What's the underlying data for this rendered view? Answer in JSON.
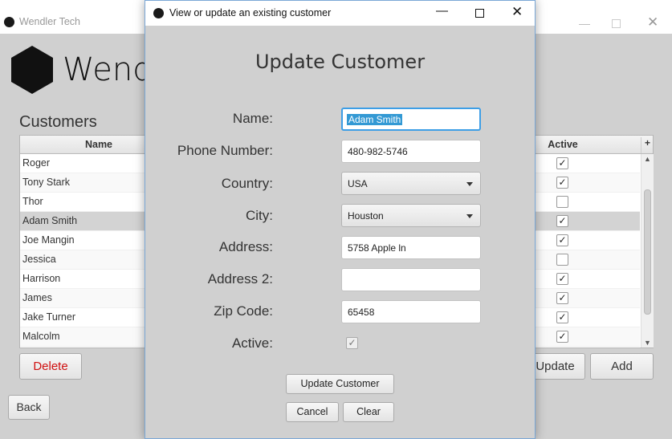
{
  "main_window": {
    "title": "Wendler Tech",
    "brand": "Wend",
    "section_title": "Customers",
    "table": {
      "columns": {
        "name": "Name",
        "active": "Active",
        "add_column": "+"
      },
      "rows": [
        {
          "name": "Roger",
          "active": "✓"
        },
        {
          "name": "Tony Stark",
          "active": "✓"
        },
        {
          "name": "Thor",
          "active": ""
        },
        {
          "name": "Adam Smith",
          "active": "✓"
        },
        {
          "name": "Joe Mangin",
          "active": "✓"
        },
        {
          "name": "Jessica",
          "active": ""
        },
        {
          "name": "Harrison",
          "active": "✓"
        },
        {
          "name": "James",
          "active": "✓"
        },
        {
          "name": "Jake Turner",
          "active": "✓"
        },
        {
          "name": "Malcolm",
          "active": "✓"
        }
      ],
      "selected_row": "Adam Smith"
    },
    "buttons": {
      "delete": "Delete",
      "update": "Update",
      "add": "Add",
      "back": "Back"
    }
  },
  "dialog": {
    "title": "View or update an existing customer",
    "heading": "Update Customer",
    "fields": {
      "name": {
        "label": "Name:",
        "value": "Adam Smith"
      },
      "phone": {
        "label": "Phone Number:",
        "value": "480-982-5746"
      },
      "country": {
        "label": "Country:",
        "value": "USA"
      },
      "city": {
        "label": "City:",
        "value": "Houston"
      },
      "address": {
        "label": "Address:",
        "value": "5758 Apple ln"
      },
      "address2": {
        "label": "Address 2:",
        "value": ""
      },
      "zip": {
        "label": "Zip Code:",
        "value": "65458"
      },
      "active": {
        "label": "Active:",
        "checked": "✓"
      }
    },
    "buttons": {
      "update": "Update Customer",
      "cancel": "Cancel",
      "clear": "Clear"
    }
  },
  "icons": {
    "app": "app-icon",
    "minimize": "minimize-icon",
    "maximize": "maximize-icon",
    "close": "close-icon",
    "dropdown": "chevron-down-icon"
  },
  "colors": {
    "selection": "#3399d4",
    "focus": "#3d9ee6",
    "delete_text": "#d01010"
  }
}
